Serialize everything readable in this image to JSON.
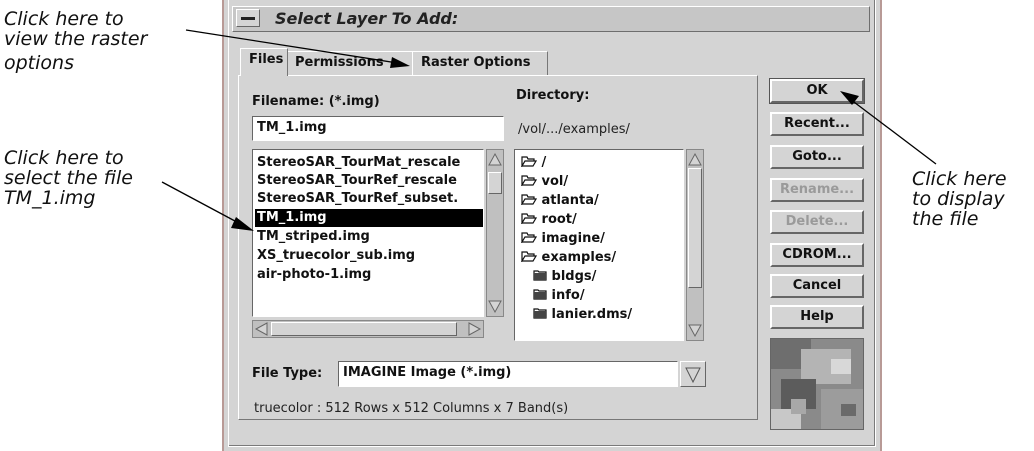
{
  "annotations": {
    "raster": [
      "Click here to",
      "view the raster",
      "options"
    ],
    "select": [
      "Click here to",
      "select the file",
      "TM_1.img"
    ],
    "display": [
      "Click here",
      "to display",
      "the file"
    ]
  },
  "dialog": {
    "title": "Select Layer To Add:",
    "tabs": [
      "Files",
      "Permissions",
      "Raster Options"
    ],
    "filename_label": "Filename: (*.img)",
    "filename_value": "TM_1.img",
    "directory_label": "Directory:",
    "directory_value": "/vol/.../examples/",
    "files": [
      "StereoSAR_TourMat_rescale",
      "StereoSAR_TourRef_rescale",
      "StereoSAR_TourRef_subset.",
      "TM_1.img",
      "TM_striped.img",
      "XS_truecolor_sub.img",
      "air-photo-1.img"
    ],
    "selected_file": "TM_1.img",
    "directories": [
      {
        "name": "/",
        "icon": "folder-open-icon"
      },
      {
        "name": "vol/",
        "icon": "folder-open-icon"
      },
      {
        "name": "atlanta/",
        "icon": "folder-open-icon"
      },
      {
        "name": "root/",
        "icon": "folder-open-icon"
      },
      {
        "name": "imagine/",
        "icon": "folder-open-icon"
      },
      {
        "name": "examples/",
        "icon": "folder-open-icon"
      },
      {
        "name": "bldgs/",
        "icon": "folder-closed-icon"
      },
      {
        "name": "info/",
        "icon": "folder-closed-icon"
      },
      {
        "name": "lanier.dms/",
        "icon": "folder-closed-icon"
      }
    ],
    "file_type_label": "File Type:",
    "file_type_value": "IMAGINE Image (*.img)",
    "info": "truecolor : 512 Rows x 512 Columns x 7 Band(s)",
    "buttons": {
      "ok": "OK",
      "recent": "Recent...",
      "goto": "Goto...",
      "rename": "Rename...",
      "delete": "Delete...",
      "cdrom": "CDROM...",
      "cancel": "Cancel",
      "help": "Help"
    }
  }
}
